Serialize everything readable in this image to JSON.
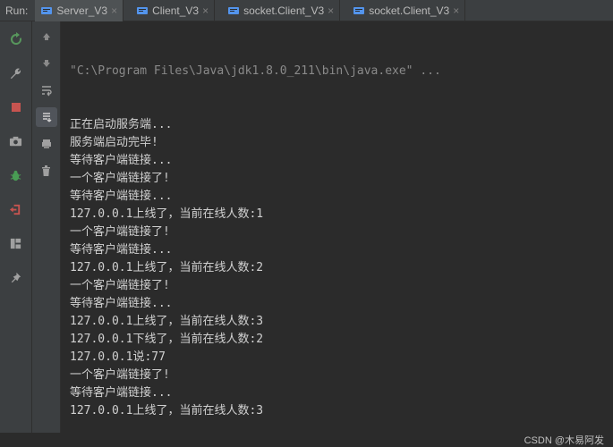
{
  "header": {
    "run_label": "Run:"
  },
  "tabs": [
    {
      "label": "Server_V3"
    },
    {
      "label": "Client_V3"
    },
    {
      "label": "socket.Client_V3"
    },
    {
      "label": "socket.Client_V3"
    }
  ],
  "console": {
    "command": "\"C:\\Program Files\\Java\\jdk1.8.0_211\\bin\\java.exe\" ...",
    "lines": [
      "正在启动服务端...",
      "服务端启动完毕!",
      "等待客户端链接...",
      "一个客户端链接了!",
      "等待客户端链接...",
      "127.0.0.1上线了，当前在线人数:1",
      "一个客户端链接了!",
      "等待客户端链接...",
      "127.0.0.1上线了，当前在线人数:2",
      "一个客户端链接了!",
      "等待客户端链接...",
      "127.0.0.1上线了，当前在线人数:3",
      "127.0.0.1下线了，当前在线人数:2",
      "127.0.0.1说:77",
      "一个客户端链接了!",
      "等待客户端链接...",
      "127.0.0.1上线了，当前在线人数:3"
    ]
  },
  "footer": {
    "watermark": "CSDN @木易阿发"
  },
  "colors": {
    "green": "#57965c",
    "red": "#c75450",
    "bug_green": "#499c54",
    "exit_red": "#c75450"
  }
}
